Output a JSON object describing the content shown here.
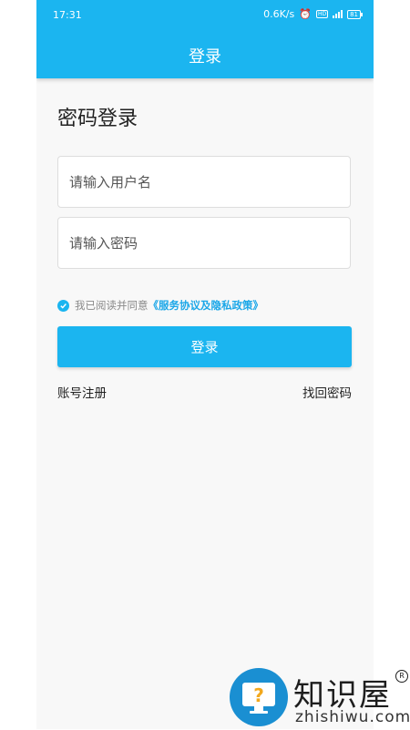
{
  "status_bar": {
    "time": "17:31",
    "network_speed": "0.6K/s",
    "battery": "81"
  },
  "appbar": {
    "title": "登录"
  },
  "page": {
    "heading": "密码登录"
  },
  "form": {
    "username_placeholder": "请输入用户名",
    "password_placeholder": "请输入密码",
    "agree_text": "我已阅读并同意",
    "agree_link": "《服务协议及隐私政策》",
    "agree_checked": true,
    "login_label": "登录"
  },
  "links": {
    "register": "账号注册",
    "forgot": "找回密码"
  },
  "watermark": {
    "name": "知识屋",
    "domain": "zhishiwu.com",
    "registered": "R"
  },
  "colors": {
    "primary": "#1bb5f0",
    "link": "#1ba7e8",
    "background": "#f8f8f8"
  }
}
